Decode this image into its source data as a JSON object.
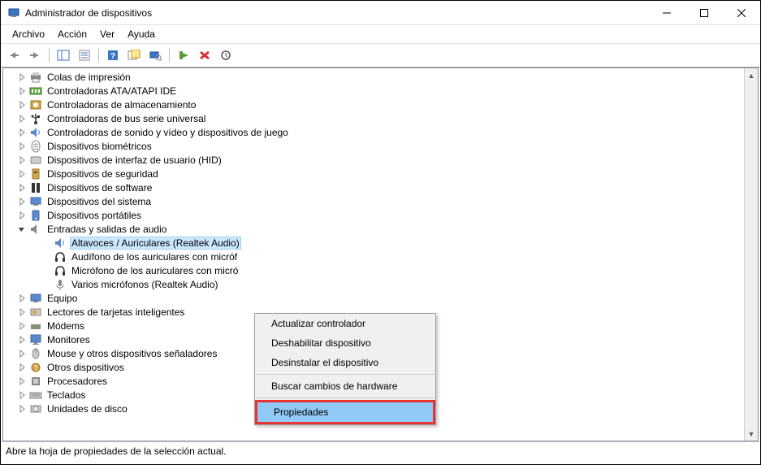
{
  "window": {
    "title": "Administrador de dispositivos"
  },
  "menu": {
    "archivo": "Archivo",
    "accion": "Acción",
    "ver": "Ver",
    "ayuda": "Ayuda"
  },
  "tree": {
    "items": [
      {
        "label": "Colas de impresión",
        "icon": "printer"
      },
      {
        "label": "Controladoras ATA/ATAPI IDE",
        "icon": "ide"
      },
      {
        "label": "Controladoras de almacenamiento",
        "icon": "storage"
      },
      {
        "label": "Controladoras de bus serie universal",
        "icon": "usb"
      },
      {
        "label": "Controladoras de sonido y vídeo y dispositivos de juego",
        "icon": "sound"
      },
      {
        "label": "Dispositivos biométricos",
        "icon": "biometric"
      },
      {
        "label": "Dispositivos de interfaz de usuario (HID)",
        "icon": "hid"
      },
      {
        "label": "Dispositivos de seguridad",
        "icon": "security"
      },
      {
        "label": "Dispositivos de software",
        "icon": "software"
      },
      {
        "label": "Dispositivos del sistema",
        "icon": "system"
      },
      {
        "label": "Dispositivos portátiles",
        "icon": "portable"
      },
      {
        "label": "Entradas y salidas de audio",
        "icon": "audio",
        "expanded": true,
        "children": [
          {
            "label": "Altavoces / Auriculares (Realtek Audio)",
            "icon": "speaker",
            "selected": true
          },
          {
            "label": "Audífono de los auriculares con micróf",
            "icon": "headphone"
          },
          {
            "label": "Micrófono de los auriculares con micró",
            "icon": "headphone"
          },
          {
            "label": "Varios micrófonos (Realtek Audio)",
            "icon": "mic"
          }
        ]
      },
      {
        "label": "Equipo",
        "icon": "computer"
      },
      {
        "label": "Lectores de tarjetas inteligentes",
        "icon": "cardreader"
      },
      {
        "label": "Módems",
        "icon": "modem"
      },
      {
        "label": "Monitores",
        "icon": "monitor"
      },
      {
        "label": "Mouse y otros dispositivos señaladores",
        "icon": "mouse"
      },
      {
        "label": "Otros dispositivos",
        "icon": "other"
      },
      {
        "label": "Procesadores",
        "icon": "cpu"
      },
      {
        "label": "Teclados",
        "icon": "keyboard"
      },
      {
        "label": "Unidades de disco",
        "icon": "disk"
      }
    ]
  },
  "context_menu": {
    "update": "Actualizar controlador",
    "disable": "Deshabilitar dispositivo",
    "uninstall": "Desinstalar el dispositivo",
    "scan": "Buscar cambios de hardware",
    "properties": "Propiedades"
  },
  "statusbar": {
    "text": "Abre la hoja de propiedades de la selección actual."
  }
}
